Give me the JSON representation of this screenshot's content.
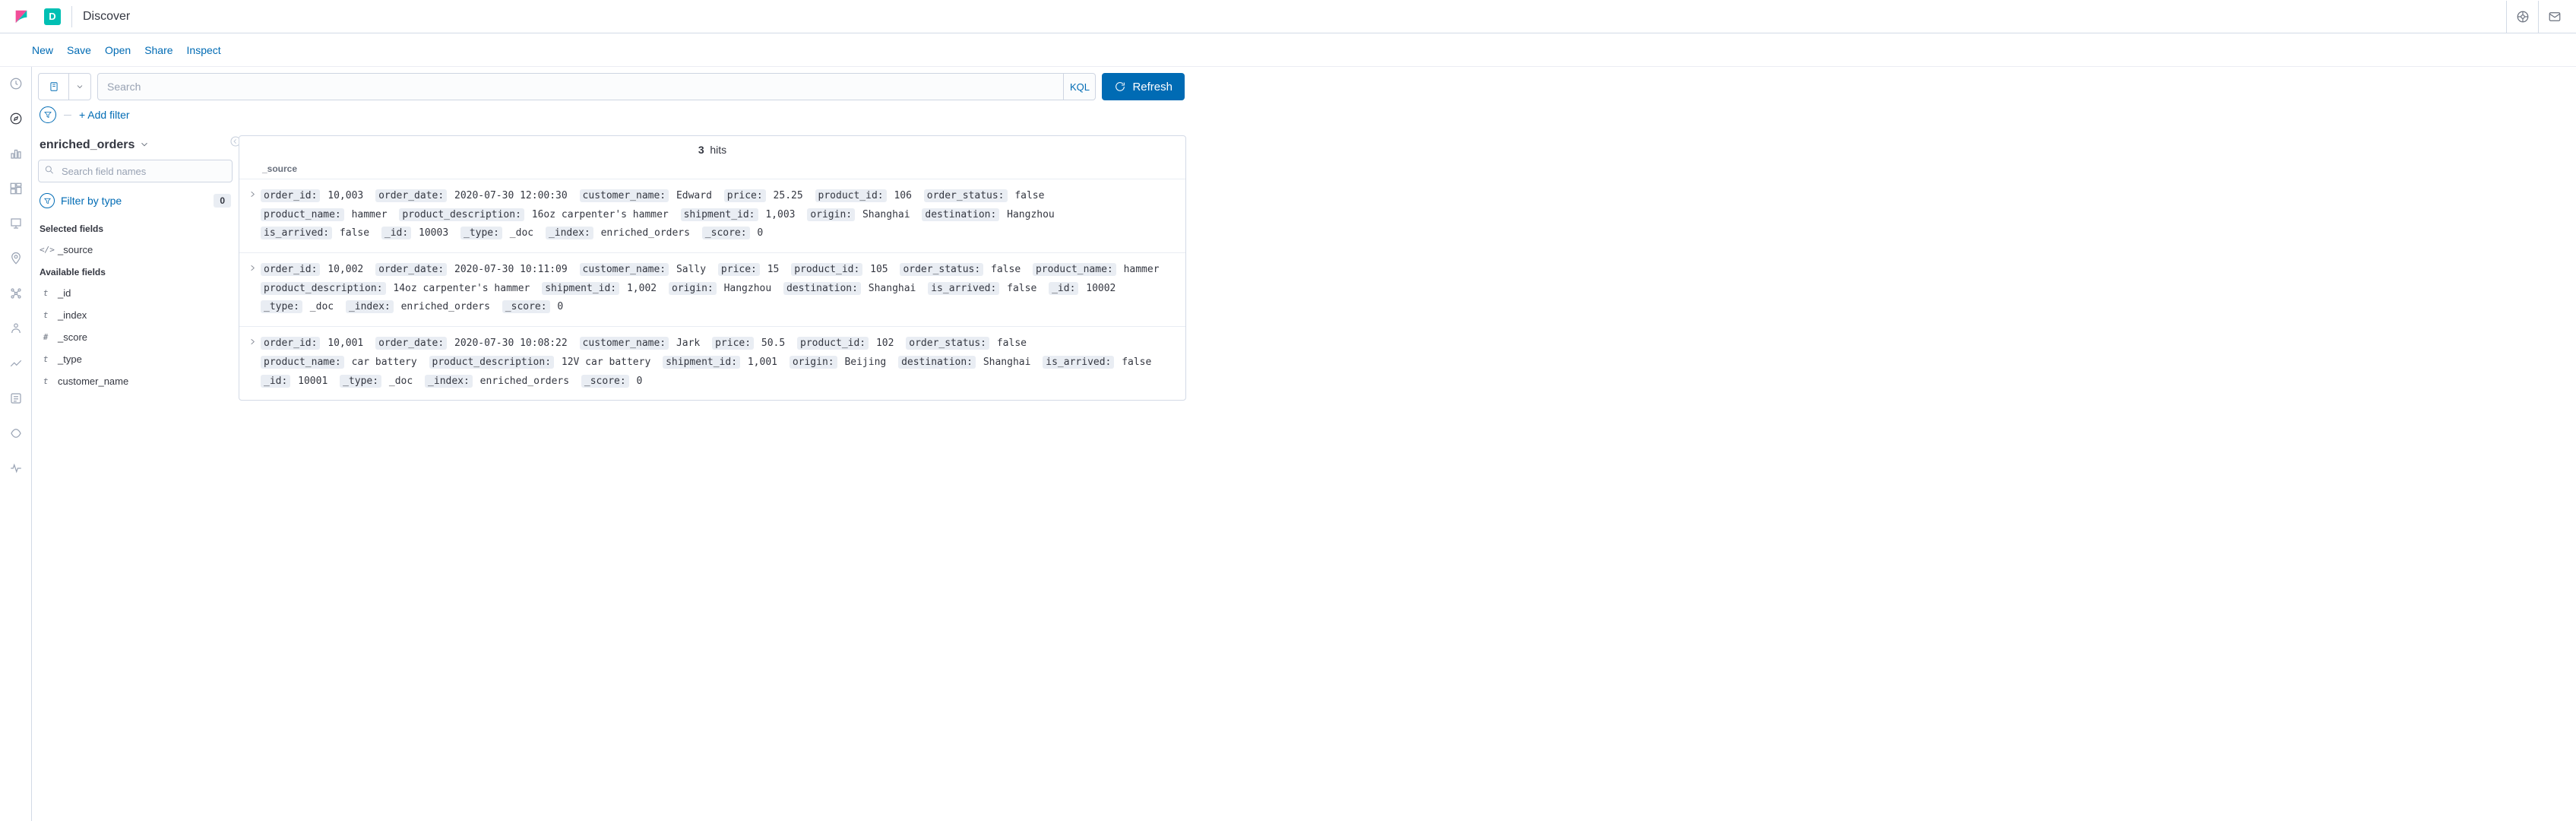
{
  "header": {
    "badge_letter": "D",
    "title": "Discover"
  },
  "toolbar": {
    "links": [
      "New",
      "Save",
      "Open",
      "Share",
      "Inspect"
    ]
  },
  "search": {
    "placeholder": "Search",
    "kql_label": "KQL",
    "refresh_label": "Refresh"
  },
  "filters": {
    "add_filter_label": "+ Add filter"
  },
  "sidebar": {
    "index_pattern": "enriched_orders",
    "field_search_placeholder": "Search field names",
    "filter_by_type_label": "Filter by type",
    "filter_type_count": "0",
    "selected_fields_title": "Selected fields",
    "available_fields_title": "Available fields",
    "selected_fields": [
      {
        "type": "code",
        "name": "_source"
      }
    ],
    "available_fields": [
      {
        "type": "t",
        "name": "_id"
      },
      {
        "type": "t",
        "name": "_index"
      },
      {
        "type": "#",
        "name": "_score"
      },
      {
        "type": "t",
        "name": "_type"
      },
      {
        "type": "t",
        "name": "customer_name"
      }
    ]
  },
  "results": {
    "hit_count": "3",
    "hits_label": "hits",
    "source_column_label": "_source",
    "docs": [
      [
        {
          "k": "order_id",
          "v": "10,003"
        },
        {
          "k": "order_date",
          "v": "2020-07-30 12:00:30"
        },
        {
          "k": "customer_name",
          "v": "Edward"
        },
        {
          "k": "price",
          "v": "25.25"
        },
        {
          "k": "product_id",
          "v": "106"
        },
        {
          "k": "order_status",
          "v": "false"
        },
        {
          "k": "product_name",
          "v": "hammer"
        },
        {
          "k": "product_description",
          "v": "16oz carpenter's hammer"
        },
        {
          "k": "shipment_id",
          "v": "1,003"
        },
        {
          "k": "origin",
          "v": "Shanghai"
        },
        {
          "k": "destination",
          "v": "Hangzhou"
        },
        {
          "k": "is_arrived",
          "v": "false"
        },
        {
          "k": "_id",
          "v": "10003"
        },
        {
          "k": "_type",
          "v": "_doc"
        },
        {
          "k": "_index",
          "v": "enriched_orders"
        },
        {
          "k": "_score",
          "v": "0"
        }
      ],
      [
        {
          "k": "order_id",
          "v": "10,002"
        },
        {
          "k": "order_date",
          "v": "2020-07-30 10:11:09"
        },
        {
          "k": "customer_name",
          "v": "Sally"
        },
        {
          "k": "price",
          "v": "15"
        },
        {
          "k": "product_id",
          "v": "105"
        },
        {
          "k": "order_status",
          "v": "false"
        },
        {
          "k": "product_name",
          "v": "hammer"
        },
        {
          "k": "product_description",
          "v": "14oz carpenter's hammer"
        },
        {
          "k": "shipment_id",
          "v": "1,002"
        },
        {
          "k": "origin",
          "v": "Hangzhou"
        },
        {
          "k": "destination",
          "v": "Shanghai"
        },
        {
          "k": "is_arrived",
          "v": "false"
        },
        {
          "k": "_id",
          "v": "10002"
        },
        {
          "k": "_type",
          "v": "_doc"
        },
        {
          "k": "_index",
          "v": "enriched_orders"
        },
        {
          "k": "_score",
          "v": "0"
        }
      ],
      [
        {
          "k": "order_id",
          "v": "10,001"
        },
        {
          "k": "order_date",
          "v": "2020-07-30 10:08:22"
        },
        {
          "k": "customer_name",
          "v": "Jark"
        },
        {
          "k": "price",
          "v": "50.5"
        },
        {
          "k": "product_id",
          "v": "102"
        },
        {
          "k": "order_status",
          "v": "false"
        },
        {
          "k": "product_name",
          "v": "car battery"
        },
        {
          "k": "product_description",
          "v": "12V car battery"
        },
        {
          "k": "shipment_id",
          "v": "1,001"
        },
        {
          "k": "origin",
          "v": "Beijing"
        },
        {
          "k": "destination",
          "v": "Shanghai"
        },
        {
          "k": "is_arrived",
          "v": "false"
        },
        {
          "k": "_id",
          "v": "10001"
        },
        {
          "k": "_type",
          "v": "_doc"
        },
        {
          "k": "_index",
          "v": "enriched_orders"
        },
        {
          "k": "_score",
          "v": "0"
        }
      ]
    ]
  }
}
